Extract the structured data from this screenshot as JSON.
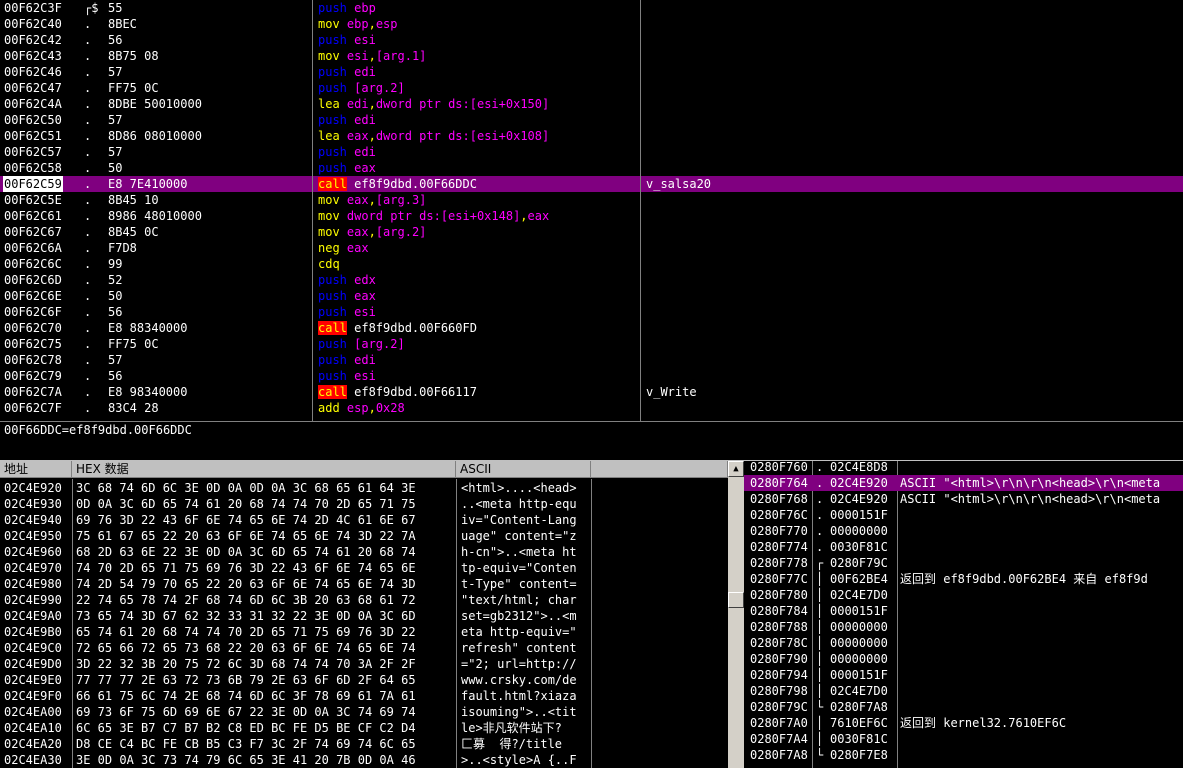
{
  "disasm": {
    "rows": [
      {
        "addr": "00F62C3F",
        "mark": "┌$",
        "hex": "55",
        "ins": [
          [
            "push ",
            "c-push"
          ],
          [
            "ebp",
            "c-reg"
          ]
        ],
        "cmt": ""
      },
      {
        "addr": "00F62C40",
        "mark": ".",
        "hex": "8BEC",
        "ins": [
          [
            "mov ",
            "c-mov"
          ],
          [
            "ebp",
            "c-reg"
          ],
          [
            ",",
            "c-op"
          ],
          [
            "esp",
            "c-reg"
          ]
        ],
        "cmt": ""
      },
      {
        "addr": "00F62C42",
        "mark": ".",
        "hex": "56",
        "ins": [
          [
            "push ",
            "c-push"
          ],
          [
            "esi",
            "c-reg"
          ]
        ],
        "cmt": ""
      },
      {
        "addr": "00F62C43",
        "mark": ".",
        "hex": "8B75 08",
        "ins": [
          [
            "mov ",
            "c-mov"
          ],
          [
            "esi",
            "c-reg"
          ],
          [
            ",",
            "c-op"
          ],
          [
            "[arg.1]",
            "c-mem"
          ]
        ],
        "cmt": ""
      },
      {
        "addr": "00F62C46",
        "mark": ".",
        "hex": "57",
        "ins": [
          [
            "push ",
            "c-push"
          ],
          [
            "edi",
            "c-reg"
          ]
        ],
        "cmt": ""
      },
      {
        "addr": "00F62C47",
        "mark": ".",
        "hex": "FF75 0C",
        "ins": [
          [
            "push ",
            "c-push"
          ],
          [
            "[arg.2]",
            "c-mem"
          ]
        ],
        "cmt": ""
      },
      {
        "addr": "00F62C4A",
        "mark": ".",
        "hex": "8DBE 50010000",
        "ins": [
          [
            "lea ",
            "c-lea"
          ],
          [
            "edi",
            "c-reg"
          ],
          [
            ",",
            "c-op"
          ],
          [
            "dword ptr ds:[esi+0x150]",
            "c-mem"
          ]
        ],
        "cmt": ""
      },
      {
        "addr": "00F62C50",
        "mark": ".",
        "hex": "57",
        "ins": [
          [
            "push ",
            "c-push"
          ],
          [
            "edi",
            "c-reg"
          ]
        ],
        "cmt": ""
      },
      {
        "addr": "00F62C51",
        "mark": ".",
        "hex": "8D86 08010000",
        "ins": [
          [
            "lea ",
            "c-lea"
          ],
          [
            "eax",
            "c-reg"
          ],
          [
            ",",
            "c-op"
          ],
          [
            "dword ptr ds:[esi+0x108]",
            "c-mem"
          ]
        ],
        "cmt": ""
      },
      {
        "addr": "00F62C57",
        "mark": ".",
        "hex": "57",
        "ins": [
          [
            "push ",
            "c-push"
          ],
          [
            "edi",
            "c-reg"
          ]
        ],
        "cmt": ""
      },
      {
        "addr": "00F62C58",
        "mark": ".",
        "hex": "50",
        "ins": [
          [
            "push ",
            "c-push"
          ],
          [
            "eax",
            "c-reg"
          ]
        ],
        "cmt": ""
      },
      {
        "addr": "00F62C59",
        "mark": ".",
        "hex": "E8 7E410000",
        "ins": [
          [
            "call",
            "c-call"
          ],
          [
            " ef8f9dbd.00F66DDC",
            "c-plain"
          ]
        ],
        "cmt": "v_salsa20",
        "sel": true
      },
      {
        "addr": "00F62C5E",
        "mark": ".",
        "hex": "8B45 10",
        "ins": [
          [
            "mov ",
            "c-mov"
          ],
          [
            "eax",
            "c-reg"
          ],
          [
            ",",
            "c-op"
          ],
          [
            "[arg.3]",
            "c-mem"
          ]
        ],
        "cmt": ""
      },
      {
        "addr": "00F62C61",
        "mark": ".",
        "hex": "8986 48010000",
        "ins": [
          [
            "mov ",
            "c-mov"
          ],
          [
            "dword ptr ds:[esi+0x148]",
            "c-mem"
          ],
          [
            ",",
            "c-op"
          ],
          [
            "eax",
            "c-reg"
          ]
        ],
        "cmt": ""
      },
      {
        "addr": "00F62C67",
        "mark": ".",
        "hex": "8B45 0C",
        "ins": [
          [
            "mov ",
            "c-mov"
          ],
          [
            "eax",
            "c-reg"
          ],
          [
            ",",
            "c-op"
          ],
          [
            "[arg.2]",
            "c-mem"
          ]
        ],
        "cmt": ""
      },
      {
        "addr": "00F62C6A",
        "mark": ".",
        "hex": "F7D8",
        "ins": [
          [
            "neg ",
            "c-misc"
          ],
          [
            "eax",
            "c-reg"
          ]
        ],
        "cmt": ""
      },
      {
        "addr": "00F62C6C",
        "mark": ".",
        "hex": "99",
        "ins": [
          [
            "cdq",
            "c-misc"
          ]
        ],
        "cmt": ""
      },
      {
        "addr": "00F62C6D",
        "mark": ".",
        "hex": "52",
        "ins": [
          [
            "push ",
            "c-push"
          ],
          [
            "edx",
            "c-reg"
          ]
        ],
        "cmt": ""
      },
      {
        "addr": "00F62C6E",
        "mark": ".",
        "hex": "50",
        "ins": [
          [
            "push ",
            "c-push"
          ],
          [
            "eax",
            "c-reg"
          ]
        ],
        "cmt": ""
      },
      {
        "addr": "00F62C6F",
        "mark": ".",
        "hex": "56",
        "ins": [
          [
            "push ",
            "c-push"
          ],
          [
            "esi",
            "c-reg"
          ]
        ],
        "cmt": ""
      },
      {
        "addr": "00F62C70",
        "mark": ".",
        "hex": "E8 88340000",
        "ins": [
          [
            "call",
            "c-call"
          ],
          [
            " ef8f9dbd.00F660FD",
            "c-plain"
          ]
        ],
        "cmt": ""
      },
      {
        "addr": "00F62C75",
        "mark": ".",
        "hex": "FF75 0C",
        "ins": [
          [
            "push ",
            "c-push"
          ],
          [
            "[arg.2]",
            "c-mem"
          ]
        ],
        "cmt": ""
      },
      {
        "addr": "00F62C78",
        "mark": ".",
        "hex": "57",
        "ins": [
          [
            "push ",
            "c-push"
          ],
          [
            "edi",
            "c-reg"
          ]
        ],
        "cmt": ""
      },
      {
        "addr": "00F62C79",
        "mark": ".",
        "hex": "56",
        "ins": [
          [
            "push ",
            "c-push"
          ],
          [
            "esi",
            "c-reg"
          ]
        ],
        "cmt": ""
      },
      {
        "addr": "00F62C7A",
        "mark": ".",
        "hex": "E8 98340000",
        "ins": [
          [
            "call",
            "c-call"
          ],
          [
            " ef8f9dbd.00F66117",
            "c-plain"
          ]
        ],
        "cmt": "v_Write"
      },
      {
        "addr": "00F62C7F",
        "mark": ".",
        "hex": "83C4 28",
        "ins": [
          [
            "add ",
            "c-misc"
          ],
          [
            "esp",
            "c-reg"
          ],
          [
            ",",
            "c-op"
          ],
          [
            "0x28",
            "c-num"
          ]
        ],
        "cmt": ""
      }
    ]
  },
  "info": {
    "text": "00F66DDC=ef8f9dbd.00F66DDC"
  },
  "dump": {
    "headers": {
      "addr": "地址",
      "hex": "HEX 数据",
      "ascii": "ASCII"
    },
    "rows": [
      {
        "a": "02C4E920",
        "h": "3C 68 74 6D 6C 3E 0D 0A 0D 0A 3C 68 65 61 64 3E",
        "s": "<html>....<head>"
      },
      {
        "a": "02C4E930",
        "h": "0D 0A 3C 6D 65 74 61 20 68 74 74 70 2D 65 71 75",
        "s": "..<meta http-equ"
      },
      {
        "a": "02C4E940",
        "h": "69 76 3D 22 43 6F 6E 74 65 6E 74 2D 4C 61 6E 67",
        "s": "iv=\"Content-Lang"
      },
      {
        "a": "02C4E950",
        "h": "75 61 67 65 22 20 63 6F 6E 74 65 6E 74 3D 22 7A",
        "s": "uage\" content=\"z"
      },
      {
        "a": "02C4E960",
        "h": "68 2D 63 6E 22 3E 0D 0A 3C 6D 65 74 61 20 68 74",
        "s": "h-cn\">..<meta ht"
      },
      {
        "a": "02C4E970",
        "h": "74 70 2D 65 71 75 69 76 3D 22 43 6F 6E 74 65 6E",
        "s": "tp-equiv=\"Conten"
      },
      {
        "a": "02C4E980",
        "h": "74 2D 54 79 70 65 22 20 63 6F 6E 74 65 6E 74 3D",
        "s": "t-Type\" content="
      },
      {
        "a": "02C4E990",
        "h": "22 74 65 78 74 2F 68 74 6D 6C 3B 20 63 68 61 72",
        "s": "\"text/html; char"
      },
      {
        "a": "02C4E9A0",
        "h": "73 65 74 3D 67 62 32 33 31 32 22 3E 0D 0A 3C 6D",
        "s": "set=gb2312\">..<m"
      },
      {
        "a": "02C4E9B0",
        "h": "65 74 61 20 68 74 74 70 2D 65 71 75 69 76 3D 22",
        "s": "eta http-equiv=\""
      },
      {
        "a": "02C4E9C0",
        "h": "72 65 66 72 65 73 68 22 20 63 6F 6E 74 65 6E 74",
        "s": "refresh\" content"
      },
      {
        "a": "02C4E9D0",
        "h": "3D 22 32 3B 20 75 72 6C 3D 68 74 74 70 3A 2F 2F",
        "s": "=\"2; url=http://"
      },
      {
        "a": "02C4E9E0",
        "h": "77 77 77 2E 63 72 73 6B 79 2E 63 6F 6D 2F 64 65",
        "s": "www.crsky.com/de"
      },
      {
        "a": "02C4E9F0",
        "h": "66 61 75 6C 74 2E 68 74 6D 6C 3F 78 69 61 7A 61",
        "s": "fault.html?xiaza"
      },
      {
        "a": "02C4EA00",
        "h": "69 73 6F 75 6D 69 6E 67 22 3E 0D 0A 3C 74 69 74",
        "s": "isouming\">..<tit"
      },
      {
        "a": "02C4EA10",
        "h": "6C 65 3E B7 C7 B7 B2 C8 ED BC FE D5 BE CF C2 D4",
        "s": "le>非凡软件站下?"
      },
      {
        "a": "02C4EA20",
        "h": "D8 CE C4 BC FE CB B5 C3 F7 3C 2F 74 69 74 6C 65",
        "s": "匚募  得?/title"
      },
      {
        "a": "02C4EA30",
        "h": "3E 0D 0A 3C 73 74 79 6C 65 3E 41 20 7B 0D 0A 46",
        "s": ">..<style>A {..F"
      }
    ]
  },
  "scroll": {
    "up": "▲"
  },
  "stack": {
    "rows": [
      {
        "a": "0280F760",
        "b": ".",
        "v": "02C4E8D8",
        "c": ""
      },
      {
        "a": "0280F764",
        "b": ".",
        "v": "02C4E920",
        "c": "ASCII \"<html>\\r\\n\\r\\n<head>\\r\\n<meta",
        "sel": true
      },
      {
        "a": "0280F768",
        "b": ".",
        "v": "02C4E920",
        "c": "ASCII \"<html>\\r\\n\\r\\n<head>\\r\\n<meta"
      },
      {
        "a": "0280F76C",
        "b": ".",
        "v": "0000151F",
        "c": ""
      },
      {
        "a": "0280F770",
        "b": ".",
        "v": "00000000",
        "c": ""
      },
      {
        "a": "0280F774",
        "b": ".",
        "v": "0030F81C",
        "c": ""
      },
      {
        "a": "0280F778",
        "b": "┌",
        "v": "0280F79C",
        "c": ""
      },
      {
        "a": "0280F77C",
        "b": "│",
        "v": "00F62BE4",
        "c": "返回到 ef8f9dbd.00F62BE4 来自 ef8f9d"
      },
      {
        "a": "0280F780",
        "b": "│",
        "v": "02C4E7D0",
        "c": ""
      },
      {
        "a": "0280F784",
        "b": "│",
        "v": "0000151F",
        "c": ""
      },
      {
        "a": "0280F788",
        "b": "│",
        "v": "00000000",
        "c": ""
      },
      {
        "a": "0280F78C",
        "b": "│",
        "v": "00000000",
        "c": ""
      },
      {
        "a": "0280F790",
        "b": "│",
        "v": "00000000",
        "c": ""
      },
      {
        "a": "0280F794",
        "b": "│",
        "v": "0000151F",
        "c": ""
      },
      {
        "a": "0280F798",
        "b": "│",
        "v": "02C4E7D0",
        "c": ""
      },
      {
        "a": "0280F79C",
        "b": "└",
        "v": "0280F7A8",
        "c": ""
      },
      {
        "a": "0280F7A0",
        "b": "│",
        "v": "7610EF6C",
        "c": "返回到 kernel32.7610EF6C"
      },
      {
        "a": "0280F7A4",
        "b": "│",
        "v": "0030F81C",
        "c": ""
      },
      {
        "a": "0280F7A8",
        "b": "└",
        "v": "0280F7E8",
        "c": ""
      }
    ]
  }
}
